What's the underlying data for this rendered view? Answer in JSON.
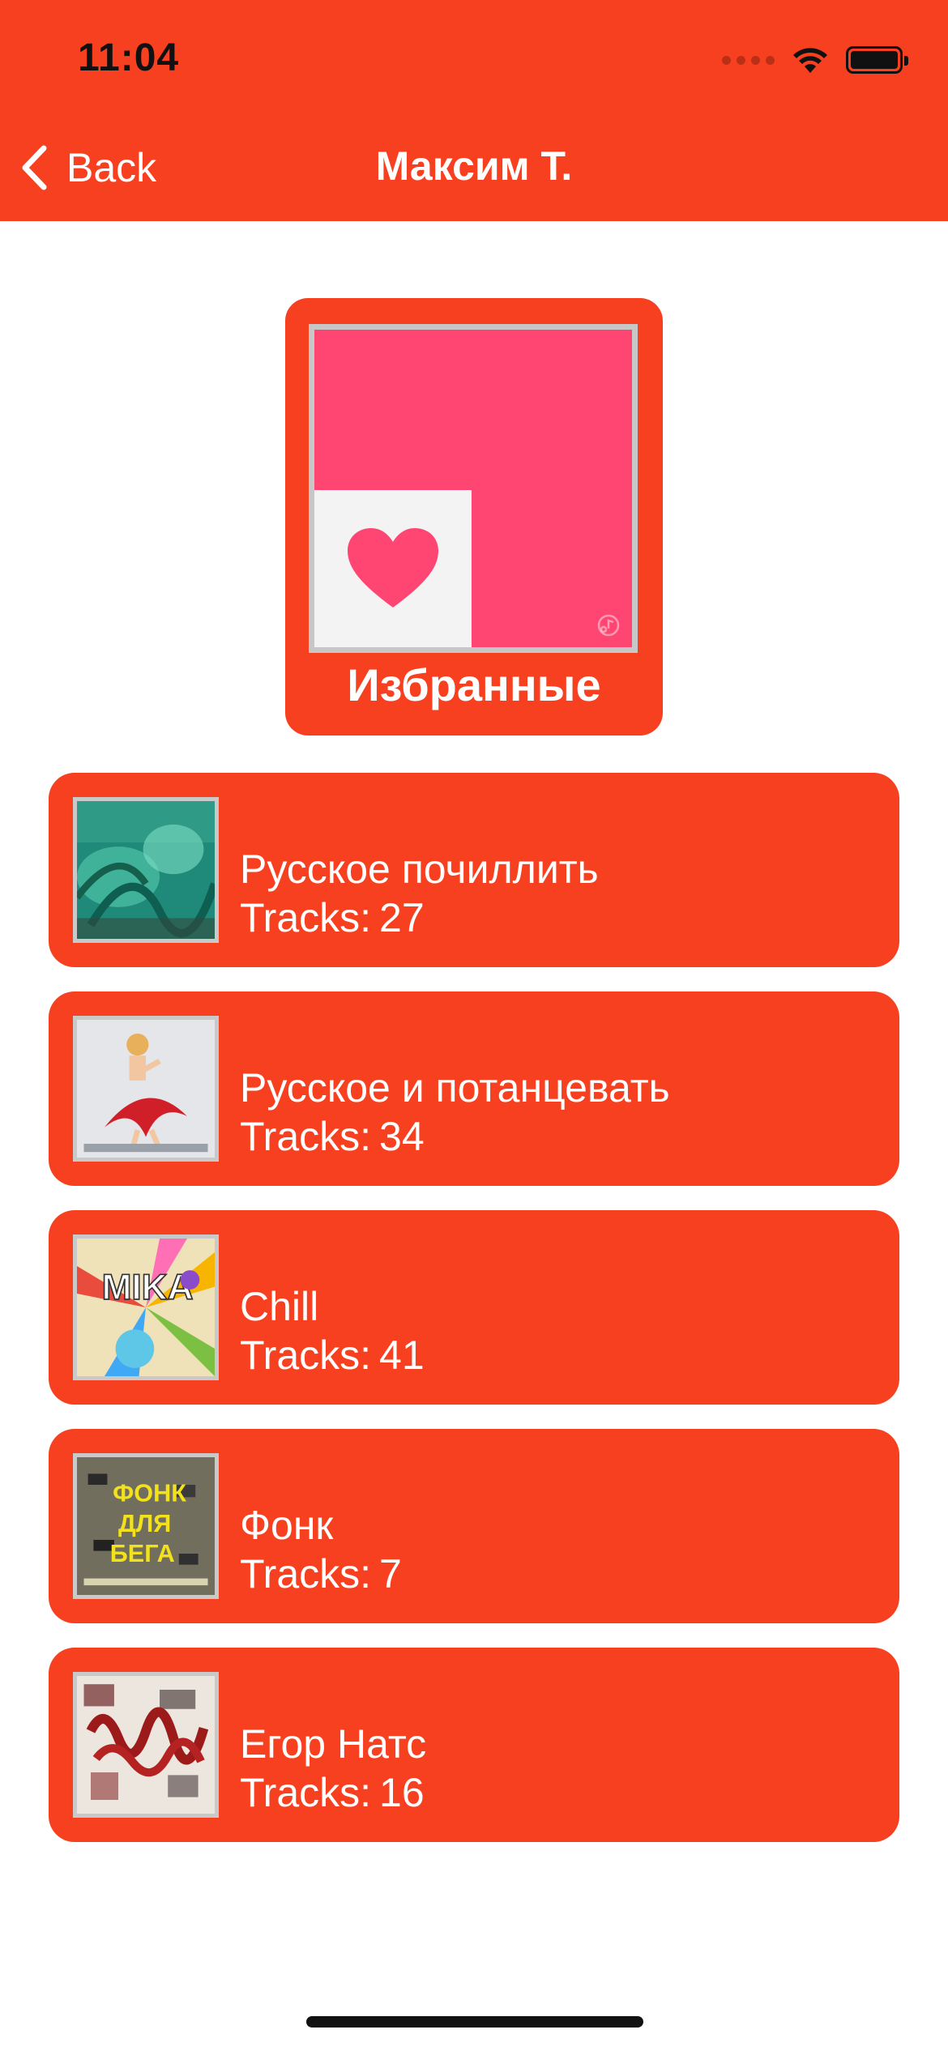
{
  "status_bar": {
    "time": "11:04",
    "icons": [
      "cellular-signal-icon",
      "wifi-icon",
      "battery-icon"
    ]
  },
  "nav": {
    "back_label": "Back",
    "back_icon": "chevron-left-icon",
    "title": "Максим Т."
  },
  "favorites": {
    "label": "Избранные",
    "icon": "heart-icon",
    "cover_color": "#FF4673"
  },
  "playlists": [
    {
      "title": "Русское почиллить",
      "tracks_label": "Tracks:",
      "tracks": "27"
    },
    {
      "title": "Русское и потанцевать",
      "tracks_label": "Tracks:",
      "tracks": "34"
    },
    {
      "title": "Chill",
      "tracks_label": "Tracks:",
      "tracks": "41"
    },
    {
      "title": "Фонк",
      "tracks_label": "Tracks:",
      "tracks": "7"
    },
    {
      "title": "Егор Натс",
      "tracks_label": "Tracks:",
      "tracks": "16"
    }
  ],
  "colors": {
    "accent": "#F7401F",
    "text_on_accent": "#FFFFFF",
    "heart": "#FF4673"
  }
}
